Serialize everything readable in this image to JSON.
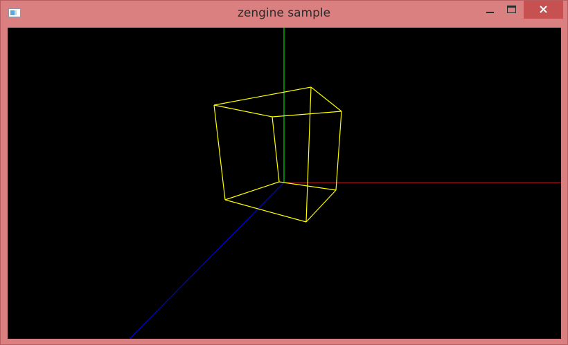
{
  "window": {
    "title": "zengine sample",
    "app_icon": "window-app-icon",
    "controls": {
      "minimize_icon": "minimize-icon",
      "maximize_icon": "maximize-icon",
      "close_icon": "close-icon"
    },
    "colors": {
      "frame": "#db8081",
      "close_button": "#c75050",
      "viewport_background": "#000000"
    }
  },
  "scene": {
    "axes": [
      {
        "name": "x-axis",
        "color": "#ff0000"
      },
      {
        "name": "y-axis",
        "color": "#00ff00"
      },
      {
        "name": "z-axis",
        "color": "#0000ff"
      }
    ],
    "wireframe_cube": {
      "color": "#ffff00"
    }
  }
}
